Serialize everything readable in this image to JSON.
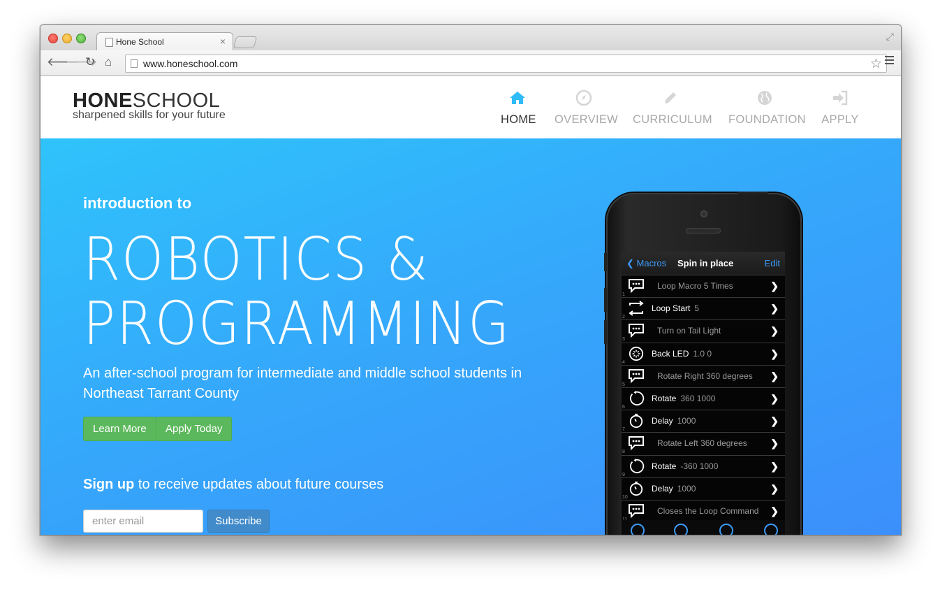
{
  "browser": {
    "tab_title": "Hone School",
    "tab_close": "×",
    "url": "www.honeschool.com",
    "icons": {
      "back": "arrow-left-icon",
      "forward": "arrow-right-icon",
      "reload": "reload-icon",
      "home": "home-icon",
      "star": "star-icon",
      "menu": "hamburger-menu-icon"
    }
  },
  "site": {
    "logo_bold": "HONE",
    "logo_light": "SCHOOL",
    "tagline": "sharpened skills for your future",
    "nav": [
      {
        "label": "HOME",
        "icon": "home-icon",
        "active": true
      },
      {
        "label": "OVERVIEW",
        "icon": "compass-icon",
        "active": false
      },
      {
        "label": "CURRICULUM",
        "icon": "pencil-icon",
        "active": false
      },
      {
        "label": "FOUNDATION",
        "icon": "globe-icon",
        "active": false
      },
      {
        "label": "APPLY",
        "icon": "sign-in-icon",
        "active": false
      }
    ],
    "accent_color": "#2fbcf8",
    "nav_active_icon_color": "#2fbcf8"
  },
  "hero": {
    "intro": "introduction to",
    "title_line1": "ROBOTICS &",
    "title_line2": "PROGRAMMING",
    "description": "An after-school program for intermediate and middle school students in Northeast Tarrant County",
    "learn_more": "Learn More",
    "apply_today": "Apply Today",
    "signup_bold": "Sign up",
    "signup_rest": " to receive updates about future courses",
    "email_placeholder": "enter email",
    "subscribe": "Subscribe",
    "button_green": "#5cb85c",
    "button_blue": "#428bca"
  },
  "phone": {
    "back_label": "Macros",
    "title": "Spin in place",
    "edit_label": "Edit",
    "rows": [
      {
        "num": "1",
        "icon": "speech-bubble-icon",
        "label": "Loop Macro 5 Times",
        "value": "",
        "comment": true
      },
      {
        "num": "2",
        "icon": "loop-icon",
        "label": "Loop Start",
        "value": "5",
        "comment": false
      },
      {
        "num": "3",
        "icon": "speech-bubble-icon",
        "label": "Turn on Tail Light",
        "value": "",
        "comment": true
      },
      {
        "num": "4",
        "icon": "led-icon",
        "label": "Back LED",
        "value": "1.0 0",
        "comment": false
      },
      {
        "num": "5",
        "icon": "speech-bubble-icon",
        "label": "Rotate Right 360 degrees",
        "value": "",
        "comment": true
      },
      {
        "num": "6",
        "icon": "rotate-icon",
        "label": "Rotate",
        "value": "360 1000",
        "comment": false
      },
      {
        "num": "7",
        "icon": "stopwatch-icon",
        "label": "Delay",
        "value": "1000",
        "comment": false
      },
      {
        "num": "8",
        "icon": "speech-bubble-icon",
        "label": "Rotate Left 360 degrees",
        "value": "",
        "comment": true
      },
      {
        "num": "9",
        "icon": "rotate-icon",
        "label": "Rotate",
        "value": "-360 1000",
        "comment": false
      },
      {
        "num": "10",
        "icon": "stopwatch-icon",
        "label": "Delay",
        "value": "1000",
        "comment": false
      },
      {
        "num": "11",
        "icon": "speech-bubble-icon",
        "label": "Closes the Loop Command",
        "value": "",
        "comment": true
      }
    ],
    "toolbar_icons": [
      "upload-icon",
      "play-icon",
      "refresh-icon",
      "add-icon"
    ]
  }
}
